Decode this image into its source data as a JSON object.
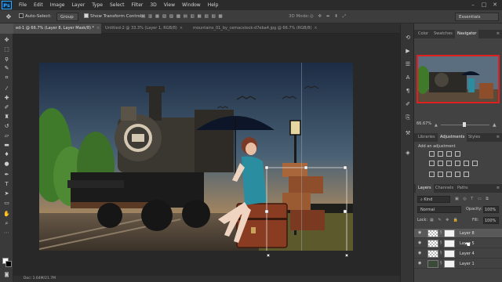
{
  "menubar": {
    "logo": "Ps",
    "items": [
      "File",
      "Edit",
      "Image",
      "Layer",
      "Type",
      "Select",
      "Filter",
      "3D",
      "View",
      "Window",
      "Help"
    ],
    "minimize": "–",
    "maximize": "□",
    "close": "✕"
  },
  "options": {
    "auto_select_label": "Auto-Select:",
    "auto_select_value": "Group",
    "show_transform_label": "Show Transform Controls",
    "mode_label": "3D Mode:",
    "workspace": "Essentials"
  },
  "tabs": [
    {
      "label": "ed-1 @ 66.7% (Layer 8, Layer Mask/8) *",
      "close": "×"
    },
    {
      "label": "Untitled-2 @ 33.3% (Layer 1, RGB/8)",
      "close": "×"
    },
    {
      "label": "mountains_01_by_cemacstock-d7eba4.jpg @ 66.7% (RGB/8)",
      "close": "×"
    }
  ],
  "status": {
    "doc_text": "Doc: 1.64M/21.7M"
  },
  "panels": {
    "top_tabs": [
      "Color",
      "Swatches",
      "Navigator"
    ],
    "zoom": "66.67%",
    "adj_tabs": [
      "Libraries",
      "Adjustments",
      "Styles"
    ],
    "add_adjustment": "Add an adjustment",
    "layer_tabs": [
      "Layers",
      "Channels",
      "Paths"
    ],
    "kind_label": "Kind",
    "blend_mode": "Normal",
    "opacity_label": "Opacity:",
    "opacity_value": "100%",
    "lock_label": "Lock:",
    "fill_label": "Fill:",
    "fill_value": "100%",
    "layers": [
      {
        "name": "Layer 8"
      },
      {
        "name": "Layer 5"
      },
      {
        "name": "Layer 4"
      },
      {
        "name": "Layer 1"
      }
    ]
  },
  "colors": {
    "accent": "#31a8ff",
    "panel_bg": "#424242",
    "canvas_bg": "#282828"
  },
  "icons": {
    "tools": [
      "move-icon",
      "marquee-icon",
      "lasso-icon",
      "quick-select-icon",
      "crop-icon",
      "eyedropper-icon",
      "healing-icon",
      "brush-icon",
      "stamp-icon",
      "history-brush-icon",
      "eraser-icon",
      "gradient-icon",
      "blur-icon",
      "dodge-icon",
      "pen-icon",
      "type-icon",
      "path-select-icon",
      "shape-icon",
      "hand-icon",
      "zoom-icon"
    ]
  }
}
